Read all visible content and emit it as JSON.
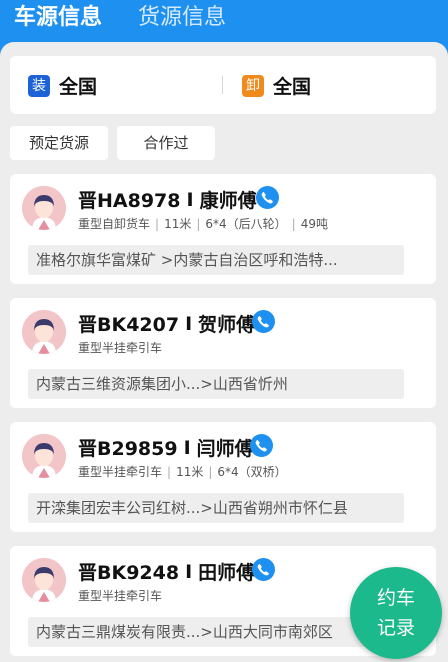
{
  "tabs": [
    {
      "label": "车源信息",
      "active": true
    },
    {
      "label": "货源信息",
      "active": false
    }
  ],
  "location": {
    "load_badge": "装",
    "load_value": "全国",
    "unload_badge": "卸",
    "unload_value": "全国"
  },
  "filters": [
    "预定货源",
    "合作过"
  ],
  "cards": [
    {
      "plate": "晋HA8978",
      "separator": "I",
      "driver": "康师傅",
      "details": [
        "重型自卸货车",
        "11米",
        "6*4（后八轮）",
        "49吨"
      ],
      "route": "准格尔旗华富煤矿        >内蒙古自治区呼和浩特..."
    },
    {
      "plate": "晋BK4207",
      "separator": "I",
      "driver": "贺师傅",
      "details": [
        "重型半挂牵引车"
      ],
      "route": "内蒙古三维资源集团小...>山西省忻州"
    },
    {
      "plate": "晋B29859",
      "separator": "I",
      "driver": "闫师傅",
      "details": [
        "重型半挂牵引车",
        "11米",
        "6*4（双桥）"
      ],
      "route": "开滦集团宏丰公司红树...>山西省朔州市怀仁县"
    },
    {
      "plate": "晋BK9248",
      "separator": "I",
      "driver": "田师傅",
      "details": [
        "重型半挂牵引车"
      ],
      "route": "内蒙古三鼎煤炭有限责...>山西大同市南郊区"
    }
  ],
  "fab": {
    "line1": "约车",
    "line2": "记录"
  },
  "colors": {
    "primary": "#1e90f0",
    "load_badge": "#1e62d8",
    "unload_badge": "#f08a1c",
    "fab": "#1cb98c"
  },
  "icons": {
    "phone": "phone-icon",
    "avatar": "driver-avatar"
  }
}
